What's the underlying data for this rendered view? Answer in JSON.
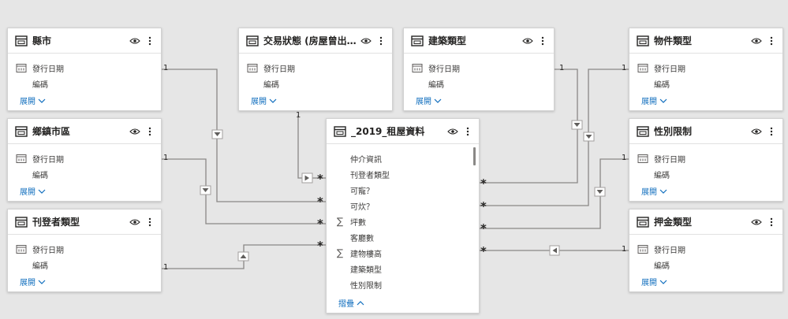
{
  "tables": {
    "city": {
      "title": "縣市",
      "fields": [
        "發行日期",
        "編碼"
      ],
      "toggle": "展開"
    },
    "district": {
      "title": "鄉鎮市區",
      "fields": [
        "發行日期",
        "編碼"
      ],
      "toggle": "展開"
    },
    "poster_type": {
      "title": "刊登者類型",
      "fields": [
        "發行日期",
        "編碼"
      ],
      "toggle": "展開"
    },
    "trade_status": {
      "title": "交易狀態 (房屋曾出租...",
      "fields": [
        "發行日期",
        "編碼"
      ],
      "toggle": "展開"
    },
    "building_type": {
      "title": "建築類型",
      "fields": [
        "發行日期",
        "編碼"
      ],
      "toggle": "展開"
    },
    "property_type": {
      "title": "物件類型",
      "fields": [
        "發行日期",
        "編碼"
      ],
      "toggle": "展開"
    },
    "gender_limit": {
      "title": "性別限制",
      "fields": [
        "發行日期",
        "編碼"
      ],
      "toggle": "展開"
    },
    "deposit_type": {
      "title": "押金類型",
      "fields": [
        "發行日期",
        "編碼"
      ],
      "toggle": "展開"
    },
    "main": {
      "title": "_2019_租屋資料",
      "fields": [
        {
          "label": "仲介資訊",
          "sigma": false
        },
        {
          "label": "刊登者類型",
          "sigma": false
        },
        {
          "label": "可寵？",
          "sigma": false
        },
        {
          "label": "可炊？",
          "sigma": false
        },
        {
          "label": "坪數",
          "sigma": true
        },
        {
          "label": "客廳數",
          "sigma": false
        },
        {
          "label": "建物樓高",
          "sigma": true
        },
        {
          "label": "建築類型",
          "sigma": false
        },
        {
          "label": "性別限制",
          "sigma": false
        }
      ],
      "toggle": "摺疊"
    }
  },
  "relationships": {
    "one_label": "1",
    "many_label": "*"
  },
  "colors": {
    "canvas": "#e6e6e6",
    "link": "#106ebe",
    "line": "#8a8886"
  }
}
